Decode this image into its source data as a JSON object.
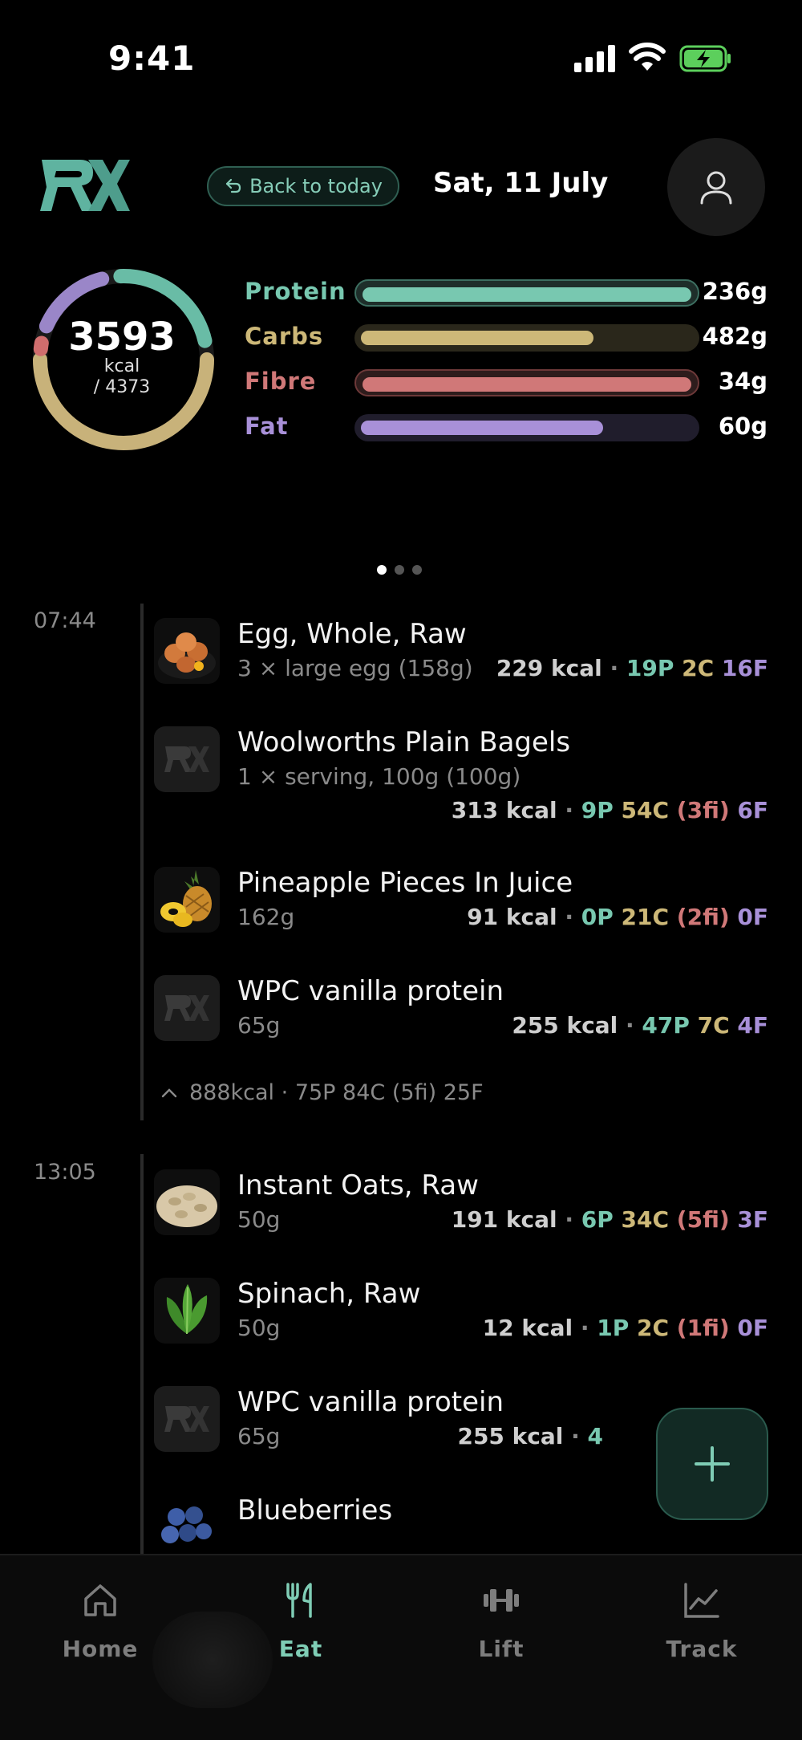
{
  "status_bar": {
    "time": "9:41"
  },
  "header": {
    "back_label": "Back to today",
    "date": "Sat, 11 July"
  },
  "summary": {
    "kcal": "3593",
    "kcal_unit": "kcal",
    "kcal_target": "/ 4373",
    "macros": [
      {
        "label": "Protein",
        "value": "236g",
        "fill": 1.0,
        "color": "#78c8b0"
      },
      {
        "label": "Carbs",
        "value": "482g",
        "fill": 0.7,
        "color": "#cdb878"
      },
      {
        "label": "Fibre",
        "value": "34g",
        "fill": 1.0,
        "color": "#d07878"
      },
      {
        "label": "Fat",
        "value": "60g",
        "fill": 0.73,
        "color": "#a890d8"
      }
    ],
    "page_dots": 3,
    "page_active": 1
  },
  "meals": [
    {
      "time": "07:44",
      "items": [
        {
          "name": "Egg, Whole, Raw",
          "serving": "3 × large egg (158g)",
          "kcal": "229 kcal",
          "p": "19P",
          "c": "2C",
          "fi": "",
          "f": "16F",
          "thumb": "egg"
        },
        {
          "name": "Woolworths Plain Bagels",
          "serving": "1 × serving, 100g (100g)",
          "kcal": "313 kcal",
          "p": "9P",
          "c": "54C",
          "fi": "(3fi)",
          "f": "6F",
          "thumb": "rx"
        },
        {
          "name": "Pineapple Pieces In Juice",
          "serving": "162g",
          "kcal": "91 kcal",
          "p": "0P",
          "c": "21C",
          "fi": "(2fi)",
          "f": "0F",
          "thumb": "pineapple"
        },
        {
          "name": "WPC vanilla protein",
          "serving": "65g",
          "kcal": "255 kcal",
          "p": "47P",
          "c": "7C",
          "fi": "",
          "f": "4F",
          "thumb": "rx"
        }
      ],
      "summary": {
        "kcal": "888kcal",
        "p": "75P",
        "c": "84C",
        "fi": "(5fi)",
        "f": "25F"
      }
    },
    {
      "time": "13:05",
      "items": [
        {
          "name": "Instant Oats, Raw",
          "serving": "50g",
          "kcal": "191 kcal",
          "p": "6P",
          "c": "34C",
          "fi": "(5fi)",
          "f": "3F",
          "thumb": "oats"
        },
        {
          "name": "Spinach, Raw",
          "serving": "50g",
          "kcal": "12 kcal",
          "p": "1P",
          "c": "2C",
          "fi": "(1fi)",
          "f": "0F",
          "thumb": "spinach"
        },
        {
          "name": "WPC vanilla protein",
          "serving": "65g",
          "kcal": "255 kcal",
          "p": "4",
          "c": "",
          "fi": "",
          "f": "",
          "thumb": "rx"
        },
        {
          "name": "Blueberries",
          "serving": "",
          "kcal": "",
          "p": "",
          "c": "",
          "fi": "",
          "f": "",
          "thumb": "blueberry"
        }
      ]
    }
  ],
  "tabs": [
    {
      "label": "Home",
      "icon": "home-icon",
      "active": false
    },
    {
      "label": "Eat",
      "icon": "fork-knife-icon",
      "active": true
    },
    {
      "label": "Lift",
      "icon": "dumbbell-icon",
      "active": false
    },
    {
      "label": "Track",
      "icon": "chart-icon",
      "active": false
    }
  ],
  "colors": {
    "accent": "#7fcdb5",
    "protein": "#78c8b0",
    "carbs": "#cdb878",
    "fibre": "#d07878",
    "fat": "#a890d8"
  }
}
